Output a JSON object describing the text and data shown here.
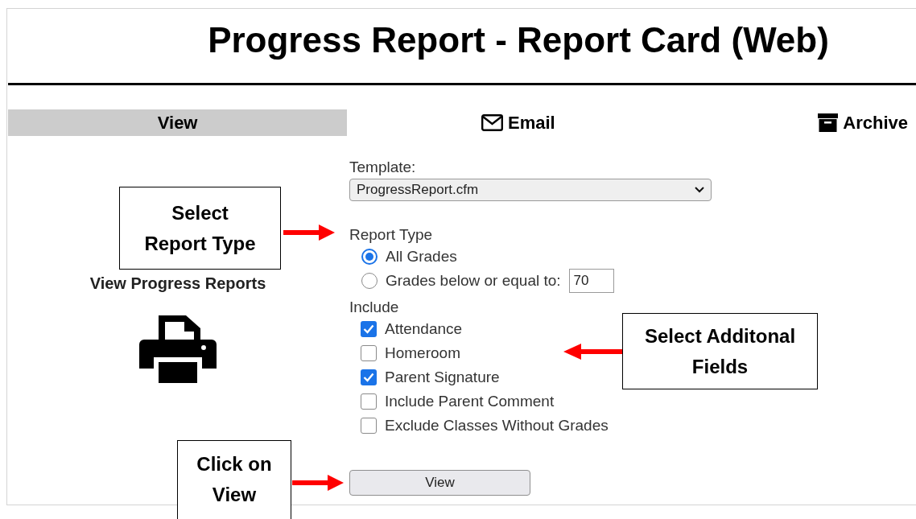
{
  "title": "Progress Report - Report Card (Web)",
  "tabs": [
    {
      "label": "View",
      "selected": true
    },
    {
      "label": "Email",
      "selected": false
    },
    {
      "label": "Archive",
      "selected": false
    }
  ],
  "side_link": {
    "label": "View Progress Reports"
  },
  "form": {
    "template_label": "Template:",
    "template_value": "ProgressReport.cfm",
    "report_type_label": "Report Type",
    "report_types": [
      {
        "label": "All Grades",
        "selected": true
      },
      {
        "label": "Grades below or equal to:",
        "selected": false,
        "value": "70"
      }
    ],
    "include_label": "Include",
    "include": [
      {
        "label": "Attendance",
        "checked": true
      },
      {
        "label": "Homeroom",
        "checked": false
      },
      {
        "label": "Parent Signature",
        "checked": true
      },
      {
        "label": "Include Parent Comment",
        "checked": false
      },
      {
        "label": "Exclude Classes Without Grades",
        "checked": false
      }
    ],
    "button": "View"
  },
  "callouts": [
    {
      "lines": [
        "Select",
        "Report Type"
      ],
      "kind": "right"
    },
    {
      "lines": [
        "Select Additonal",
        "Fields"
      ],
      "kind": "left"
    },
    {
      "lines": [
        "Click on",
        "View"
      ],
      "kind": "right"
    }
  ]
}
